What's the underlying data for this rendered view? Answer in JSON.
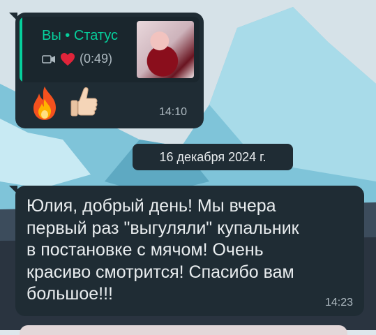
{
  "reply": {
    "author": "Вы • Статус",
    "media_duration": "(0:49)",
    "media_icons": [
      "video-camera-icon",
      "heart-icon"
    ],
    "emojis": [
      "fire-icon",
      "thumbs-up-icon"
    ],
    "time": "14:10"
  },
  "date_separator": "16 декабря 2024 г.",
  "message": {
    "text": "Юлия, добрый день! Мы вчера\nпервый раз \"выгуляли\" купальник\nв постановке с мячом! Очень\nкрасиво смотрится! Спасибо вам\nбольшое!!!",
    "time": "14:23"
  },
  "colors": {
    "bubble": "#1f2c34",
    "accent": "#06cf9c",
    "text": "#e9edef",
    "meta_text": "#aebac1"
  }
}
